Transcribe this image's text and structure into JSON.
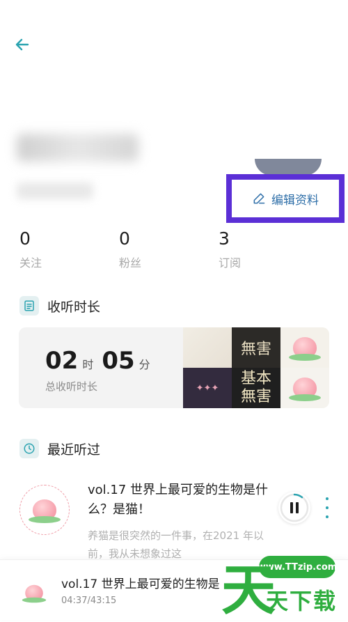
{
  "profile": {
    "edit_label": "编辑资料"
  },
  "stats": [
    {
      "value": "0",
      "label": "关注"
    },
    {
      "value": "0",
      "label": "粉丝"
    },
    {
      "value": "3",
      "label": "订阅"
    }
  ],
  "listen_time": {
    "section_title": "收听时长",
    "hours": "02",
    "hours_unit": "时",
    "minutes": "05",
    "minutes_unit": "分",
    "total_label": "总收听时长",
    "collage_texts": [
      "無害",
      "基本\n無害"
    ]
  },
  "recent": {
    "section_title": "最近听过",
    "episode": {
      "title": "vol.17 世界上最可爱的生物是什么？是猫！",
      "description": "养猫是很突然的一件事，在2021 年以前，我从未想象过这"
    }
  },
  "player": {
    "title": "vol.17 世界上最可爱的生物是",
    "time": "04:37/43:15"
  },
  "watermark": {
    "url": "www.TTzip.com",
    "big_char": "天",
    "text": "天下载"
  },
  "colors": {
    "accent": "#2aa3b0",
    "highlight_box": "#5b2fd6",
    "watermark": "#2fae3f"
  }
}
